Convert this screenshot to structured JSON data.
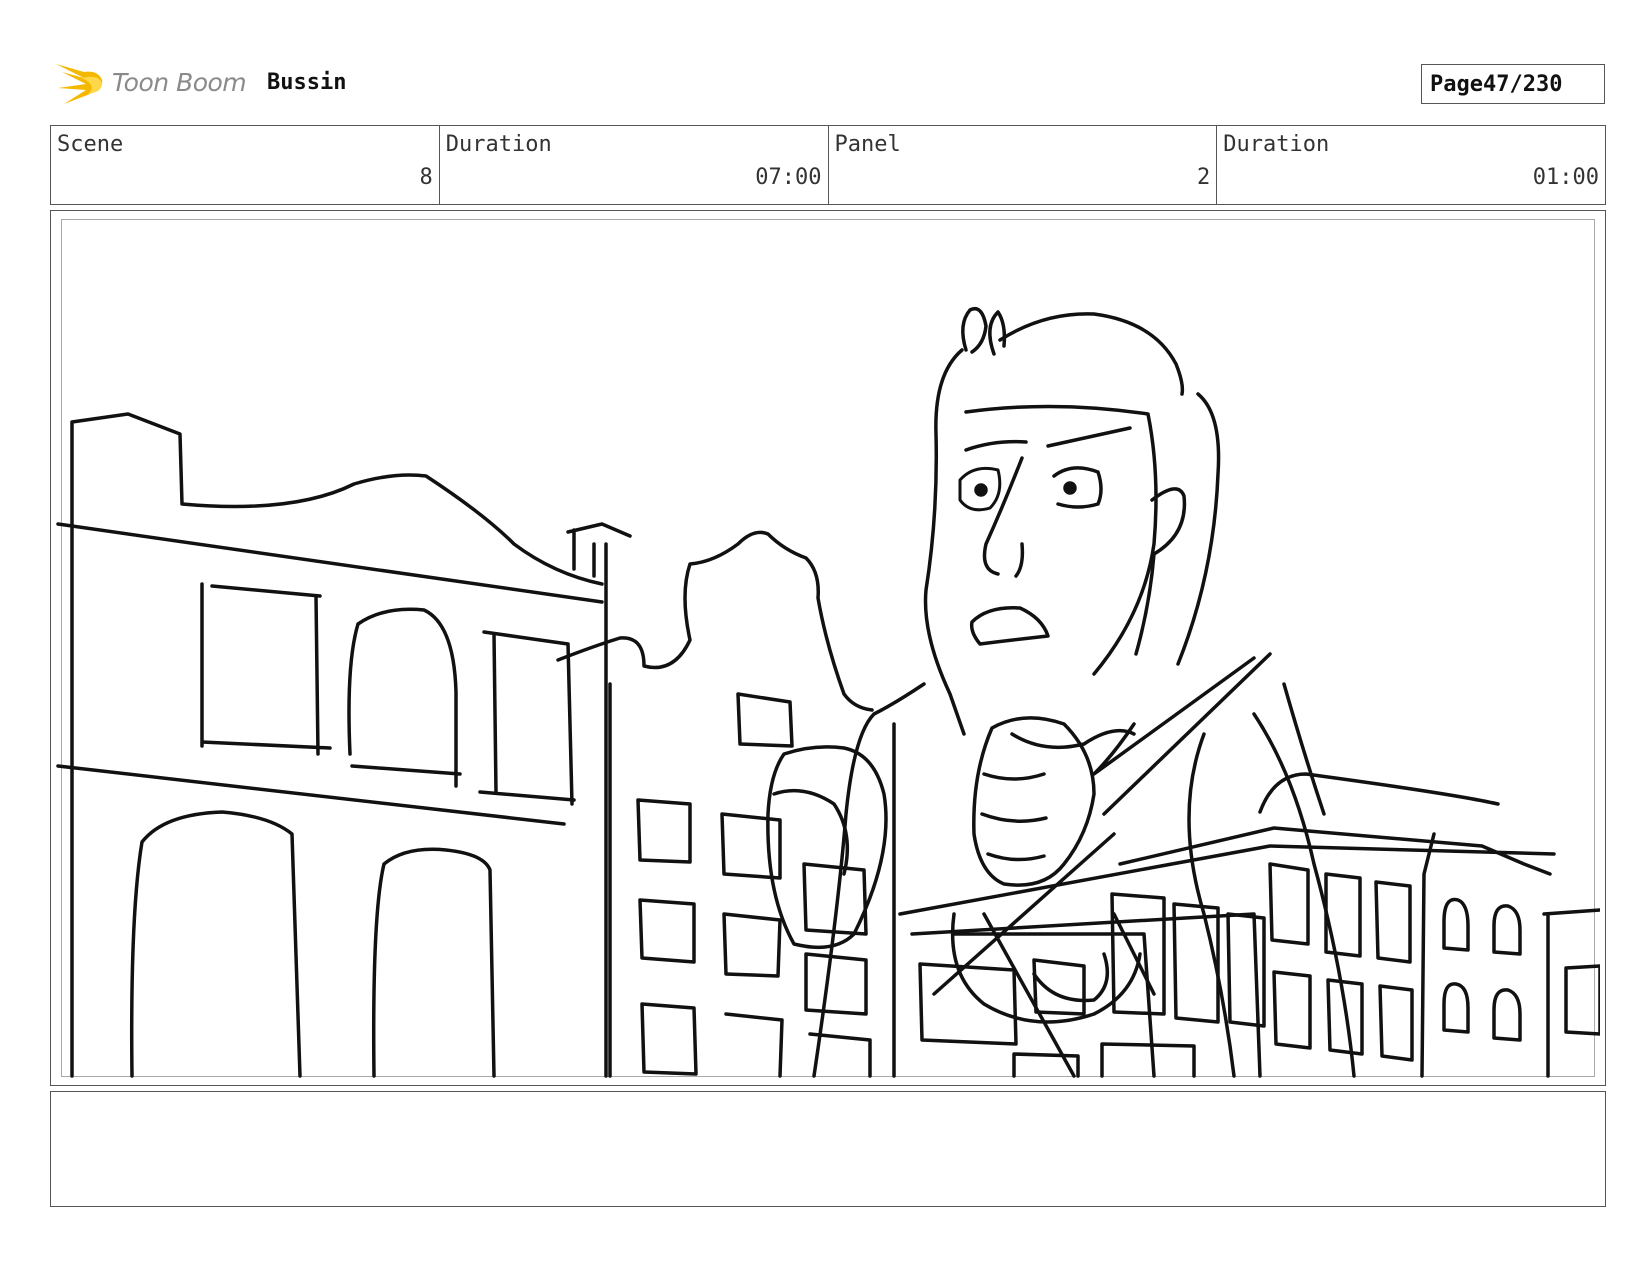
{
  "header": {
    "logo_text": "Toon Boom",
    "project_title": "Bussin",
    "page_label": "Page",
    "page_number": "47/230"
  },
  "info": {
    "scene_label": "Scene",
    "scene_value": "8",
    "scene_duration_label": "Duration",
    "scene_duration_value": "07:00",
    "panel_label": "Panel",
    "panel_value": "2",
    "panel_duration_label": "Duration",
    "panel_duration_value": "01:00"
  },
  "panel": {
    "image": "rough-sketch-man-among-buildings"
  },
  "notes": {
    "text": ""
  },
  "colors": {
    "logo_flame": "#f5b800",
    "logo_text": "#8a8a8a",
    "border": "#555555"
  }
}
